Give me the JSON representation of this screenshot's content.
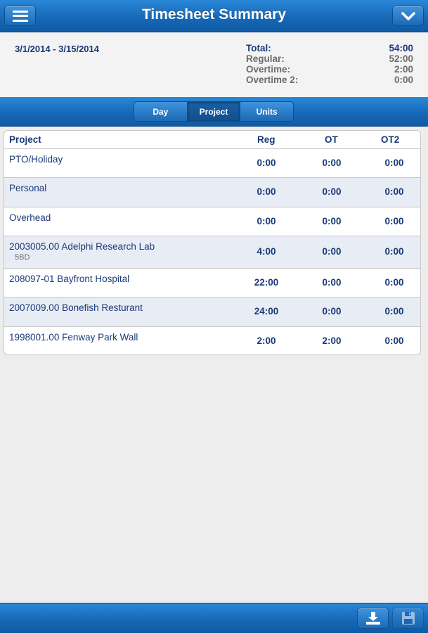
{
  "header": {
    "title": "Timesheet Summary"
  },
  "summary": {
    "date_range": "3/1/2014 - 3/15/2014",
    "rows": [
      {
        "label": "Total:",
        "value": "54:00"
      },
      {
        "label": "Regular:",
        "value": "52:00"
      },
      {
        "label": "Overtime:",
        "value": "2:00"
      },
      {
        "label": "Overtime 2:",
        "value": "0:00"
      }
    ]
  },
  "tabs": [
    {
      "label": "Day",
      "active": false
    },
    {
      "label": "Project",
      "active": true
    },
    {
      "label": "Units",
      "active": false
    }
  ],
  "table": {
    "headers": {
      "project": "Project",
      "reg": "Reg",
      "ot": "OT",
      "ot2": "OT2"
    },
    "rows": [
      {
        "project": "PTO/Holiday",
        "sub": "",
        "reg": "0:00",
        "ot": "0:00",
        "ot2": "0:00"
      },
      {
        "project": "Personal",
        "sub": "",
        "reg": "0:00",
        "ot": "0:00",
        "ot2": "0:00"
      },
      {
        "project": "Overhead",
        "sub": "",
        "reg": "0:00",
        "ot": "0:00",
        "ot2": "0:00"
      },
      {
        "project": "2003005.00 Adelphi Research Lab",
        "sub": "5BD",
        "reg": "4:00",
        "ot": "0:00",
        "ot2": "0:00"
      },
      {
        "project": "208097-01 Bayfront Hospital",
        "sub": "",
        "reg": "22:00",
        "ot": "0:00",
        "ot2": "0:00"
      },
      {
        "project": "2007009.00 Bonefish Resturant",
        "sub": "",
        "reg": "24:00",
        "ot": "0:00",
        "ot2": "0:00"
      },
      {
        "project": "1998001.00 Fenway Park Wall",
        "sub": "",
        "reg": "2:00",
        "ot": "2:00",
        "ot2": "0:00"
      }
    ]
  },
  "icons": {
    "menu": "hamburger-menu-icon",
    "dropdown": "chevron-down-icon",
    "download": "download-tray-icon",
    "save": "floppy-disk-icon"
  },
  "colors": {
    "accent": "#1769b8",
    "text": "#1a3a78",
    "row_alt": "#e8ecf4"
  }
}
